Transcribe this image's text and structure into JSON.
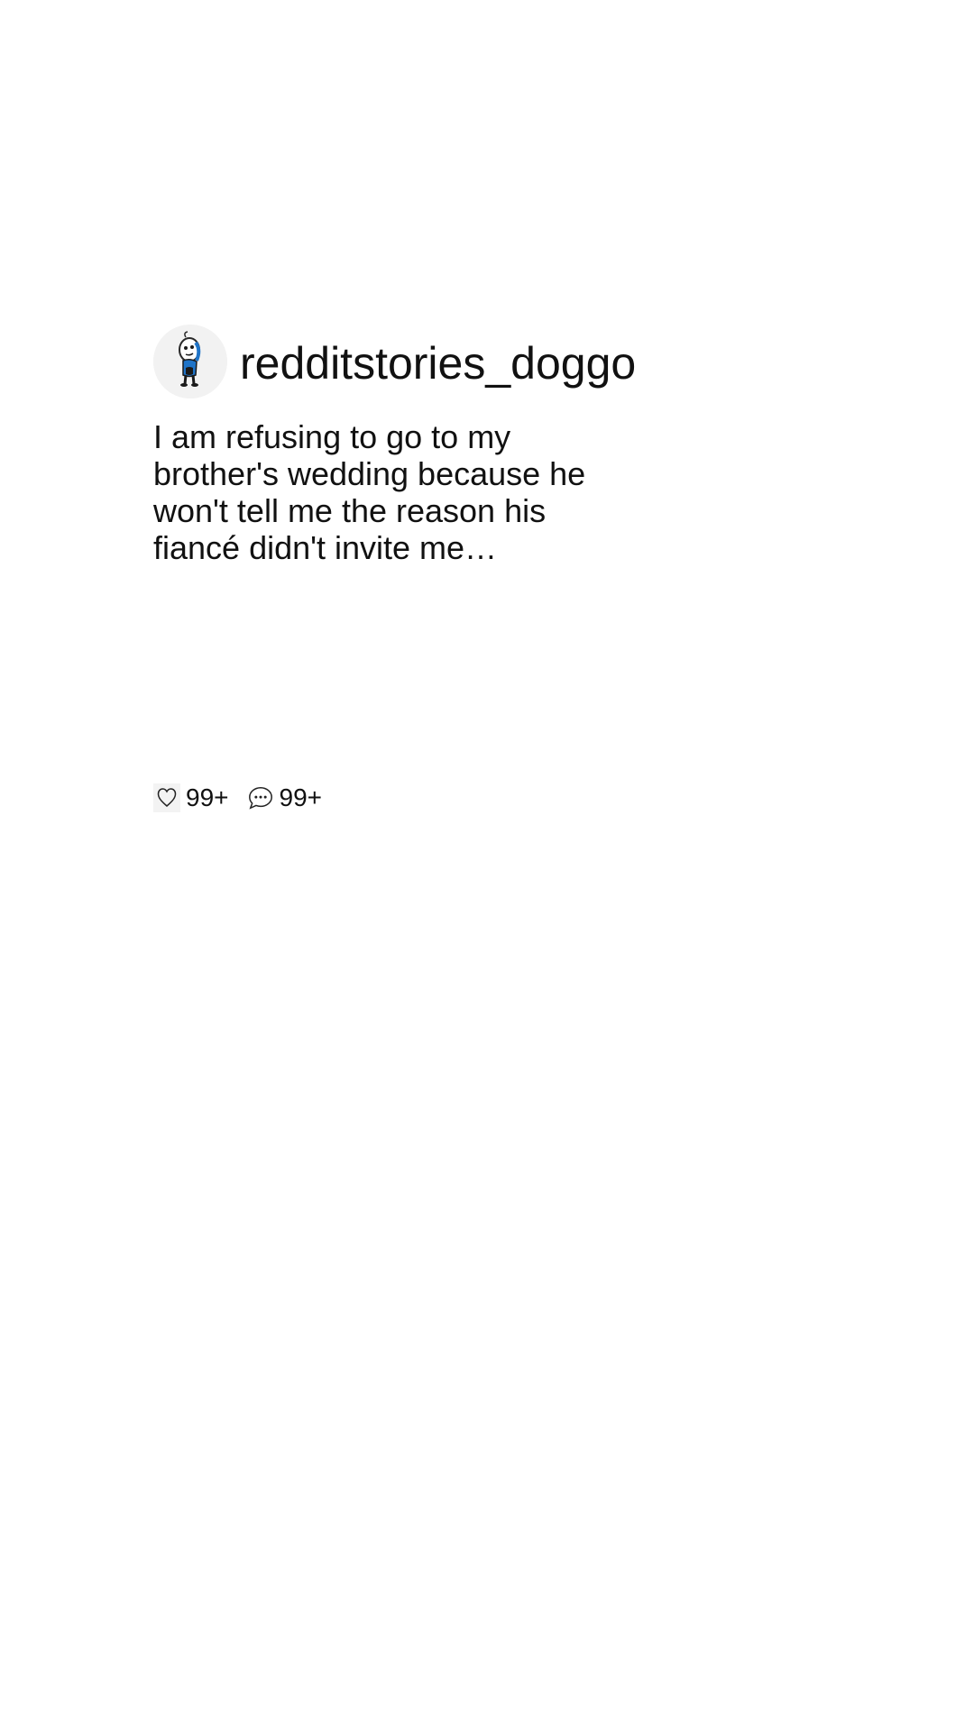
{
  "post": {
    "username": "redditstories_doggo",
    "text": "I am refusing to go to my brother's wedding because he won't tell me the reason his fiancé didn't invite me…",
    "avatar_icon": "cartoon-character-avatar"
  },
  "stats": {
    "likes": {
      "icon": "heart-icon",
      "count": "99+"
    },
    "comments": {
      "icon": "comment-bubble-icon",
      "count": "99+"
    }
  }
}
